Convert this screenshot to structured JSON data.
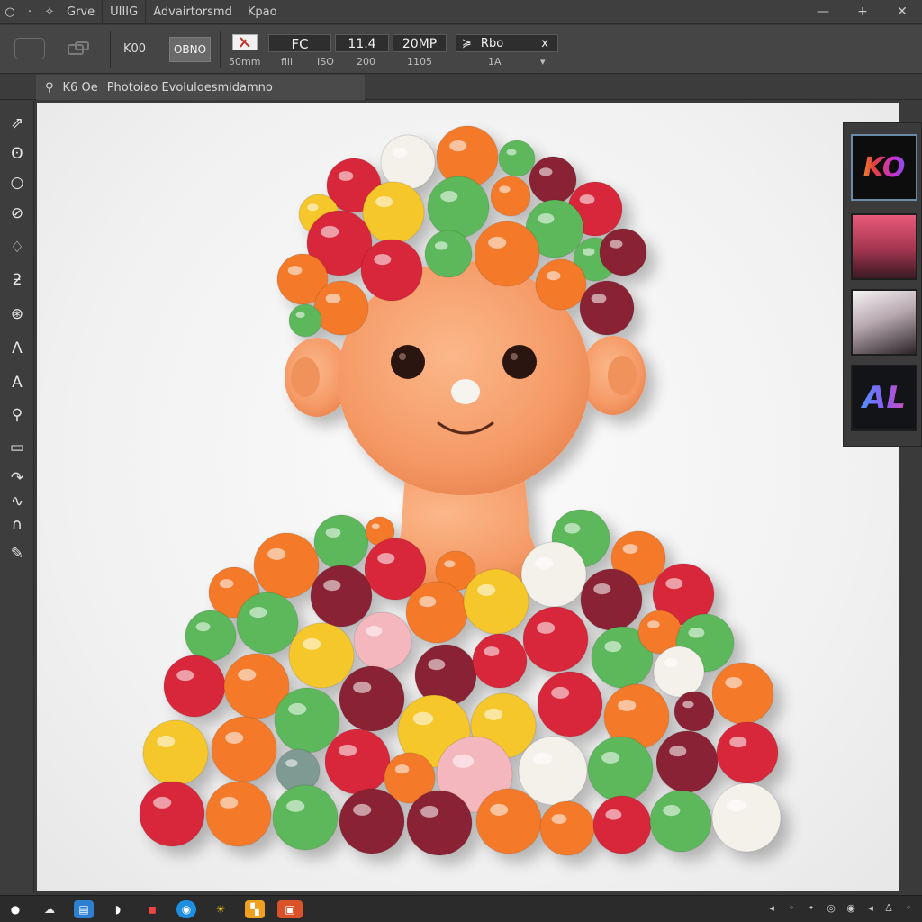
{
  "menubar": {
    "items": [
      "Grve",
      "UIIIG",
      "Advairtorsmd",
      "Kpao"
    ],
    "window_controls": [
      "—",
      "+",
      "✕"
    ]
  },
  "options": {
    "preset": "K00",
    "mode_button": "OBNO",
    "lens": "50mm",
    "fc_label": "FC",
    "fc_sub1": "fill",
    "fc_sub2": "ISO",
    "ap_value": "11.4",
    "ap_sub": "200",
    "mp_value": "20MP",
    "mp_sub": "1105",
    "channel": "Rbo",
    "channel_sub": "1A",
    "channel_close": "x"
  },
  "doc_tab": {
    "prefix": "K6 Oe",
    "title": "Photoiao Evoluloesmidamno"
  },
  "tools": [
    "move",
    "lasso",
    "ellipse-select",
    "quick-select",
    "brush",
    "pen",
    "stamp",
    "type-a",
    "type-b",
    "zoom",
    "chat",
    "hook",
    "path",
    "arc",
    "eyedropper"
  ],
  "swatches": {
    "logo1": "KO",
    "logo2": "AL"
  },
  "colors": {
    "accent": "#d9522a",
    "candy_red": "#d8283a",
    "candy_orange": "#f47a2a",
    "candy_yellow": "#f6c72c",
    "candy_green": "#5cb85a",
    "candy_maroon": "#8a2434",
    "candy_white": "#f4f1ea",
    "skin": "#f7a06e"
  },
  "taskbar": {
    "apps": [
      "start",
      "weather",
      "files",
      "browser",
      "store",
      "edge",
      "sun",
      "office",
      "photo-editor"
    ]
  }
}
